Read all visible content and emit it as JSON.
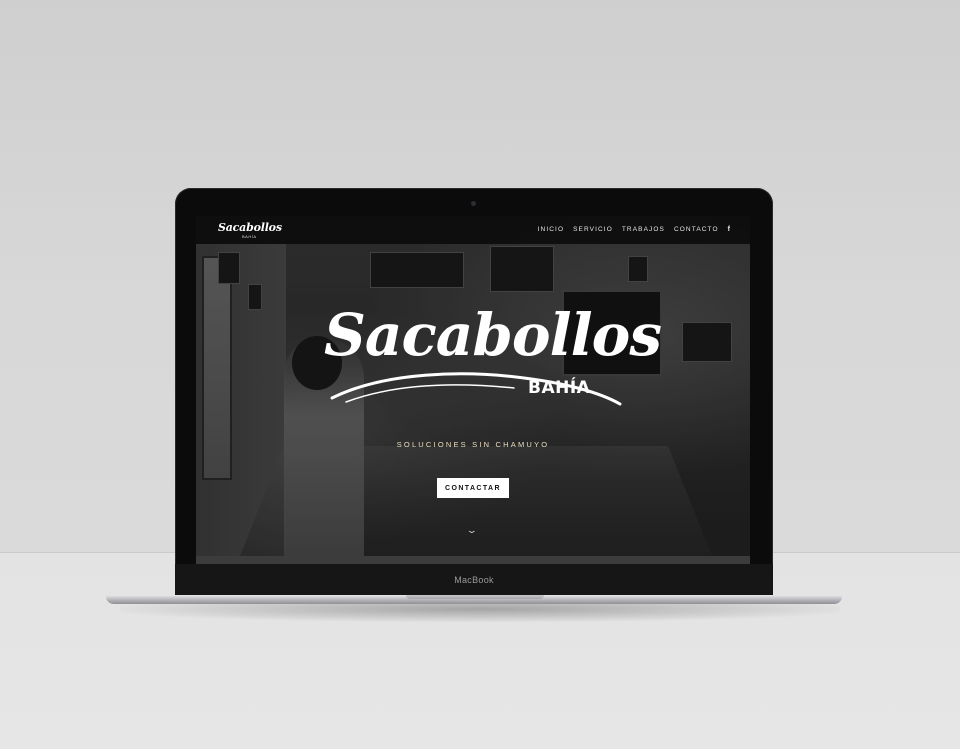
{
  "device": {
    "label": "MacBook"
  },
  "site": {
    "logo_small": "Sacabollos",
    "logo_small_sub": "BAHÍA",
    "nav": {
      "items": [
        {
          "label": "INICIO"
        },
        {
          "label": "SERVICIO"
        },
        {
          "label": "TRABAJOS"
        },
        {
          "label": "CONTACTO"
        }
      ],
      "social_icon": "facebook-icon",
      "social_glyph": "f"
    },
    "hero": {
      "title": "Sacabollos",
      "subtitle": "BAHÍA",
      "tagline": "SOLUCIONES SIN CHAMUYO",
      "cta_label": "CONTACTAR",
      "scroll_icon": "chevron-down-icon"
    }
  },
  "colors": {
    "screen_overlay": "#000000",
    "tagline": "#e8dcc0",
    "cta_bg": "#ffffff",
    "cta_text": "#111111"
  }
}
